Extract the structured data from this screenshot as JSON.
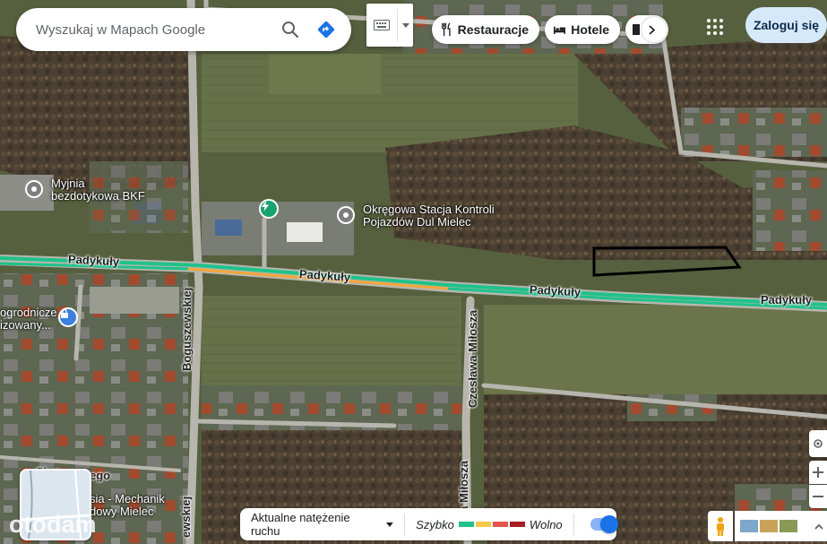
{
  "search": {
    "placeholder": "Wyszukaj w Mapach Google"
  },
  "chips": [
    {
      "label": "Restauracje",
      "icon": "fork-knife-icon"
    },
    {
      "label": "Hotele",
      "icon": "bed-icon"
    }
  ],
  "login_label": "Zaloguj się",
  "roads": {
    "padykuly_1": "Padykuły",
    "padykuly_2": "Padykuły",
    "padykuly_3": "Padykuły",
    "padykuly_4": "Padykuły",
    "boguszewskiej": "Boguszewskiej",
    "milosza": "Czesława Miłosza",
    "milosza_lower": "sława Miłosza",
    "skrz": "Skrz",
    "ego": "ego",
    "ewskiej": "ewskiej"
  },
  "pois": {
    "myjnia": "Myjnia\nbezdotykowa BKF",
    "stacja": "Okręgowa Stacja Kontroli\nPojazdów Dul Mielec",
    "ogrodnicze": "ogrodnicze\nizowany...",
    "mechanik": "sia - Mechanik\ndowy Mielec"
  },
  "traffic": {
    "label": "Aktualne natężenie ruchu",
    "fast": "Szybko",
    "slow": "Wolno",
    "colors": [
      "#1fc28b",
      "#f7c843",
      "#e8544d",
      "#a91d1f"
    ],
    "toggle_on": true
  },
  "watermark": "otodam",
  "colors": {
    "road_green": "#1fc28b",
    "road_orange": "#f4a53a",
    "parcel": "#000000"
  }
}
